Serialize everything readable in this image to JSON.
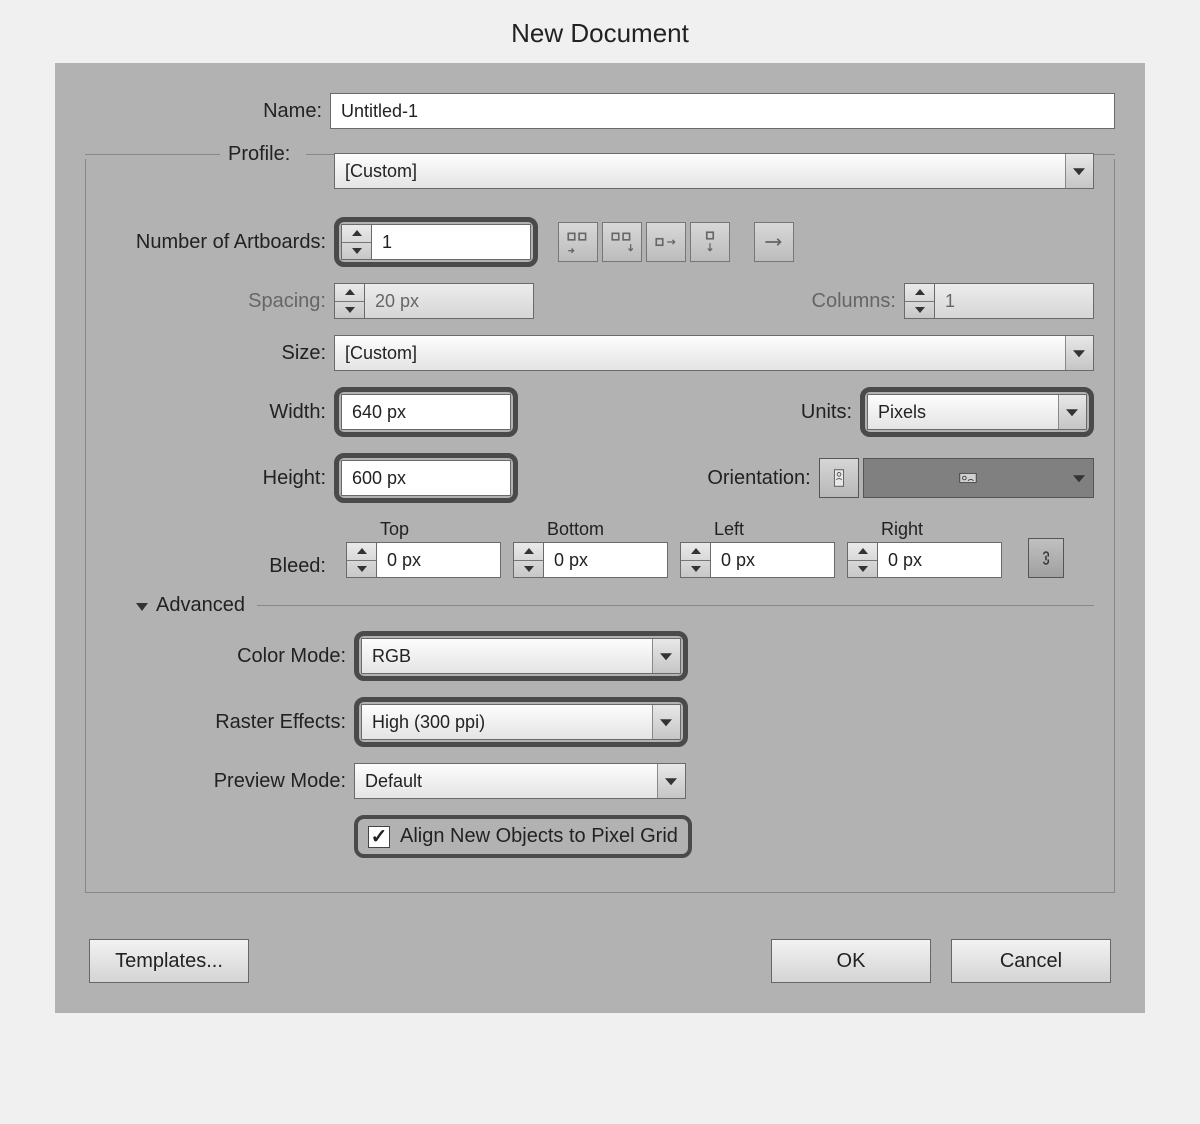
{
  "title": "New Document",
  "name": {
    "label": "Name:",
    "value": "Untitled-1"
  },
  "profile": {
    "label": "Profile:",
    "value": "[Custom]"
  },
  "artboards": {
    "label": "Number of Artboards:",
    "value": "1"
  },
  "spacing": {
    "label": "Spacing:",
    "value": "20 px"
  },
  "columns": {
    "label": "Columns:",
    "value": "1"
  },
  "size": {
    "label": "Size:",
    "value": "[Custom]"
  },
  "width": {
    "label": "Width:",
    "value": "640 px"
  },
  "height": {
    "label": "Height:",
    "value": "600 px"
  },
  "units": {
    "label": "Units:",
    "value": "Pixels"
  },
  "orientation": {
    "label": "Orientation:"
  },
  "bleed": {
    "label": "Bleed:",
    "top": {
      "label": "Top",
      "value": "0 px"
    },
    "bottom": {
      "label": "Bottom",
      "value": "0 px"
    },
    "left": {
      "label": "Left",
      "value": "0 px"
    },
    "right": {
      "label": "Right",
      "value": "0 px"
    }
  },
  "advanced": {
    "label": "Advanced",
    "colorMode": {
      "label": "Color Mode:",
      "value": "RGB"
    },
    "raster": {
      "label": "Raster Effects:",
      "value": "High (300 ppi)"
    },
    "preview": {
      "label": "Preview Mode:",
      "value": "Default"
    },
    "align": {
      "label": "Align New Objects to Pixel Grid",
      "checked": true
    }
  },
  "buttons": {
    "templates": "Templates...",
    "ok": "OK",
    "cancel": "Cancel"
  }
}
